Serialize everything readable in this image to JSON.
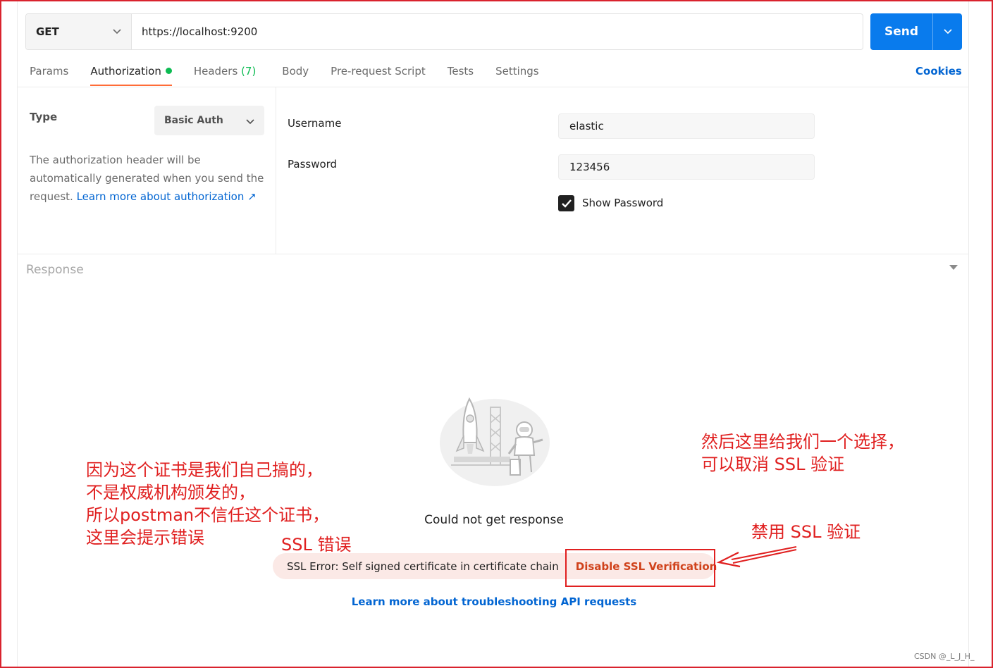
{
  "request": {
    "method": "GET",
    "url": "https://localhost:9200",
    "send_label": "Send"
  },
  "tabs": [
    {
      "label": "Params"
    },
    {
      "label": "Authorization"
    },
    {
      "label": "Headers",
      "count": "(7)"
    },
    {
      "label": "Body"
    },
    {
      "label": "Pre-request Script"
    },
    {
      "label": "Tests"
    },
    {
      "label": "Settings"
    }
  ],
  "cookies_label": "Cookies",
  "auth": {
    "type_label": "Type",
    "type_value": "Basic Auth",
    "description": "The authorization header will be automatically generated when you send the request.",
    "learn_link": "Learn more about authorization ↗",
    "username_label": "Username",
    "username_value": "elastic",
    "password_label": "Password",
    "password_value": "123456",
    "show_password_label": "Show Password",
    "show_password_checked": true
  },
  "response": {
    "title": "Response",
    "empty_message": "Could not get response",
    "ssl_error": "SSL Error: Self signed certificate in certificate chain",
    "disable_ssl": "Disable SSL Verification",
    "troubleshoot_link": "Learn more about troubleshooting API requests"
  },
  "annotations": {
    "left_lines": [
      "因为这个证书是我们自己搞的，",
      "不是权威机构颁发的，",
      "所以postman不信任这个证书，",
      "这里会提示错误"
    ],
    "ssl_error_note": "SSL 错误",
    "right_lines": [
      "然后这里给我们一个选择，",
      "可以取消 SSL 验证"
    ],
    "disable_note": "禁用 SSL 验证"
  },
  "watermark": "CSDN @_L_J_H_",
  "colors": {
    "send": "#097bed",
    "active_tab_underline": "#ff6c37",
    "link": "#0265d2",
    "annotation": "#e02020",
    "ssl_pill": "#fbe9e6"
  }
}
